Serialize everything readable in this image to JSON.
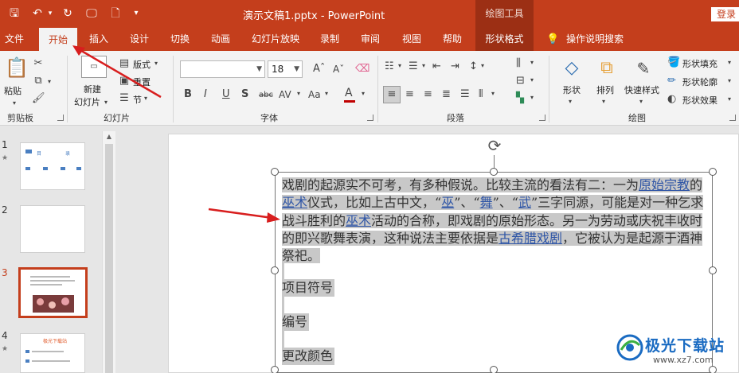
{
  "titlebar": {
    "doc_title": "演示文稿1.pptx  -  PowerPoint",
    "context_group": "绘图工具",
    "login": "登录",
    "qat": {
      "save": "🖫",
      "undo": "↶",
      "redo": "↻",
      "present": "🖵",
      "preview": "🗋",
      "customize": "▾"
    }
  },
  "tabs": [
    "文件",
    "开始",
    "插入",
    "设计",
    "切换",
    "动画",
    "幻灯片放映",
    "录制",
    "审阅",
    "视图",
    "帮助",
    "形状格式",
    "操作说明搜索"
  ],
  "ribbon": {
    "clipboard": {
      "paste": "粘贴",
      "group": "剪贴板"
    },
    "slides": {
      "new_slide_line1": "新建",
      "new_slide_line2": "幻灯片",
      "layout": "版式",
      "reset": "重置",
      "section": "节",
      "group": "幻灯片"
    },
    "font": {
      "family": "",
      "size": "18",
      "group": "字体",
      "buttons": [
        "B",
        "I",
        "U",
        "S",
        "abc",
        "AV",
        "Aa",
        "A"
      ]
    },
    "paragraph": {
      "group": "段落"
    },
    "drawing": {
      "shape": "形状",
      "arrange": "排列",
      "quick_styles": "快速样式",
      "fill": "形状填充",
      "outline": "形状轮廓",
      "effects": "形状效果",
      "group": "绘图"
    },
    "colors": {
      "accent": "#c43e1c",
      "font_color_bar": "#c00000"
    }
  },
  "thumbnails": [
    {
      "number": "1",
      "star": "★",
      "selected": false
    },
    {
      "number": "2",
      "star": "",
      "selected": false
    },
    {
      "number": "3",
      "star": "",
      "selected": true
    },
    {
      "number": "4",
      "star": "★",
      "selected": false
    }
  ],
  "thumb1_labels": [
    "目",
    "录"
  ],
  "thumb4_title": "极光下载站",
  "slide": {
    "paragraph": {
      "p1": "戏剧的起源实不可考，有多种假说。比较主流的看法有二：一为",
      "l1": "原始宗教",
      "p2": "的",
      "l2": "巫术",
      "p3": "仪式，比如上古中文，“",
      "l3": "巫",
      "p4": "”、“",
      "l4": "舞",
      "p5": "”、“",
      "l5": "武",
      "p6": "”三字同源，可能是对一种乞求战斗胜利的",
      "l6": "巫术",
      "p7": "活动的合称，即戏剧的原始形态。另一为劳动或庆祝丰收时的即兴歌舞表演，这种说法主要依据是",
      "l7": "古希腊戏剧",
      "p8": "，它被认为是起源于酒神祭祀。"
    },
    "items": [
      "项目符号",
      "编号",
      "更改颜色"
    ]
  },
  "watermark": {
    "name": "极光下载站",
    "url": "www.xz7.com"
  }
}
